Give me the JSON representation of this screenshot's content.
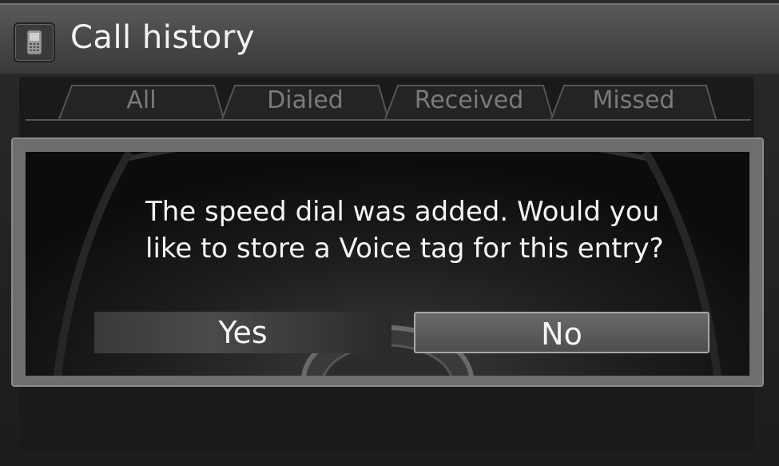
{
  "header": {
    "title": "Call history",
    "icon": "phone-icon"
  },
  "tabs": [
    {
      "label": "All"
    },
    {
      "label": "Dialed"
    },
    {
      "label": "Received"
    },
    {
      "label": "Missed"
    }
  ],
  "dialog": {
    "message_line1": "The speed dial was added. Would you",
    "message_line2": "like to store a Voice tag for this entry?",
    "yes_label": "Yes",
    "no_label": "No"
  }
}
